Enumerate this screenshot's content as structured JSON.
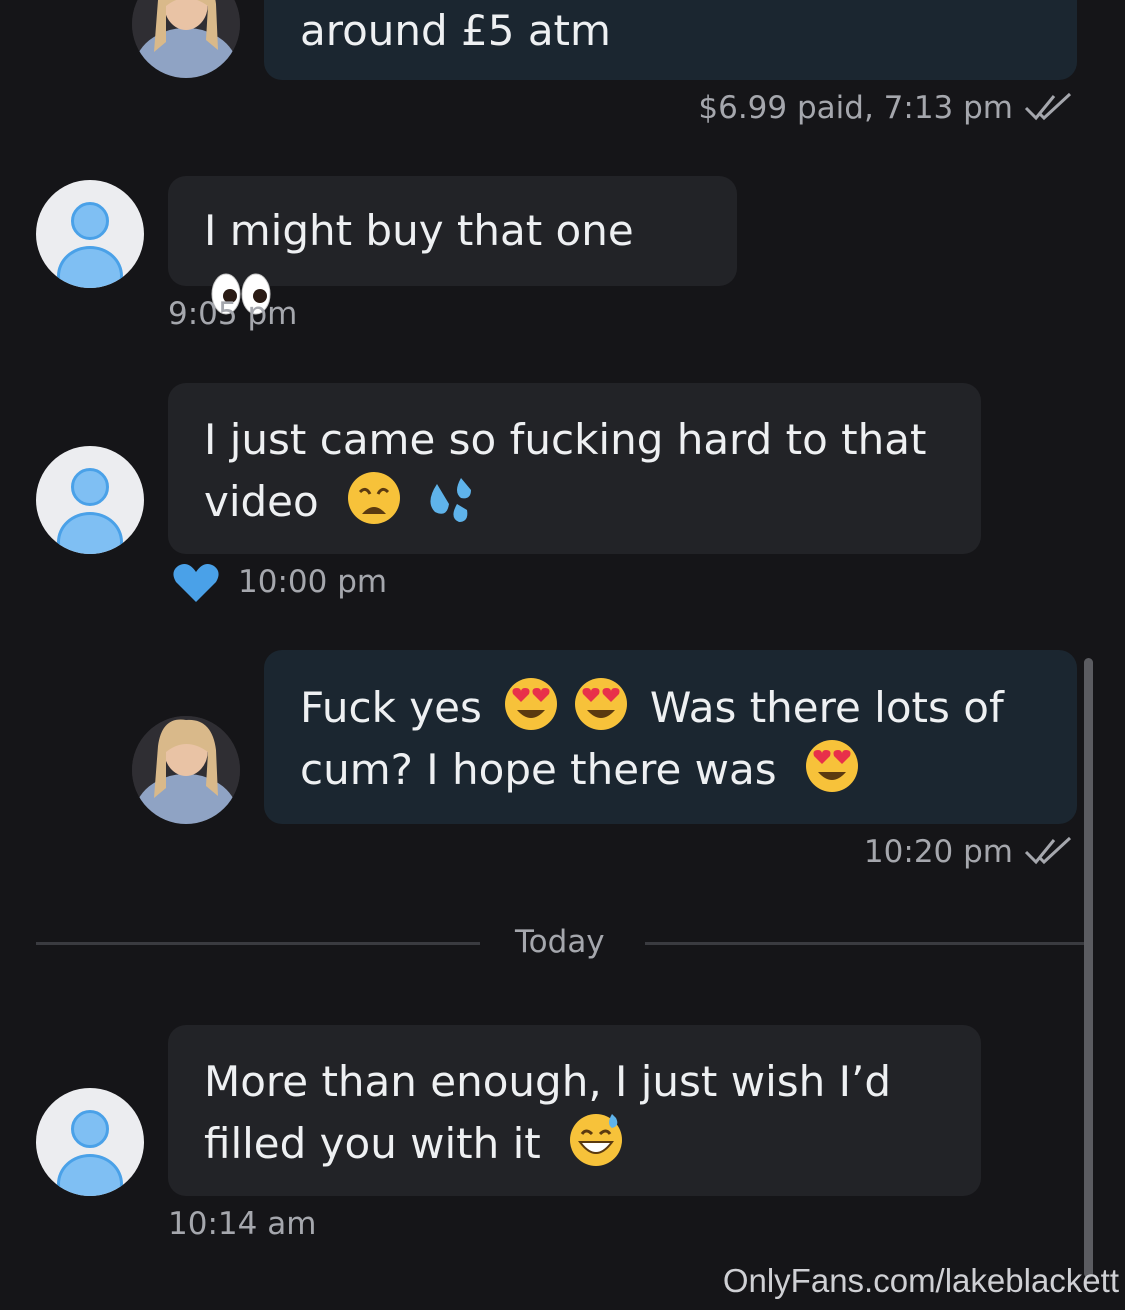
{
  "messages": [
    {
      "text": "around £5 atm",
      "meta": "$6.99 paid, 7:13 pm"
    },
    {
      "text": "I might buy that one",
      "meta": "9:05 pm"
    },
    {
      "line1": "I just came so fucking hard to that",
      "line2": "video",
      "meta": "10:00 pm"
    },
    {
      "line1a": "Fuck yes",
      "line1b": "Was there lots of",
      "line2": "cum? I hope there was",
      "meta": "10:20 pm"
    },
    {
      "line1": "More than enough, I just wish I’d",
      "line2": "filled you with it",
      "meta": "10:14 am"
    }
  ],
  "divider": {
    "label": "Today"
  },
  "watermark": "OnlyFans.com/lakeblackett",
  "icons": {
    "read_check": "double-check-icon",
    "liked": "heart-icon",
    "eyes": "eyes-emoji",
    "weary": "weary-face-emoji",
    "sweat": "sweat-droplets-emoji",
    "heart_eyes": "heart-eyes-emoji",
    "sweat_smile": "grinning-sweat-emoji"
  },
  "colors": {
    "background": "#151518",
    "incoming_bubble": "#222327",
    "outgoing_bubble": "#1b2630",
    "accent_blue": "#4aa1e8",
    "meta_text": "#a5a7ad"
  }
}
